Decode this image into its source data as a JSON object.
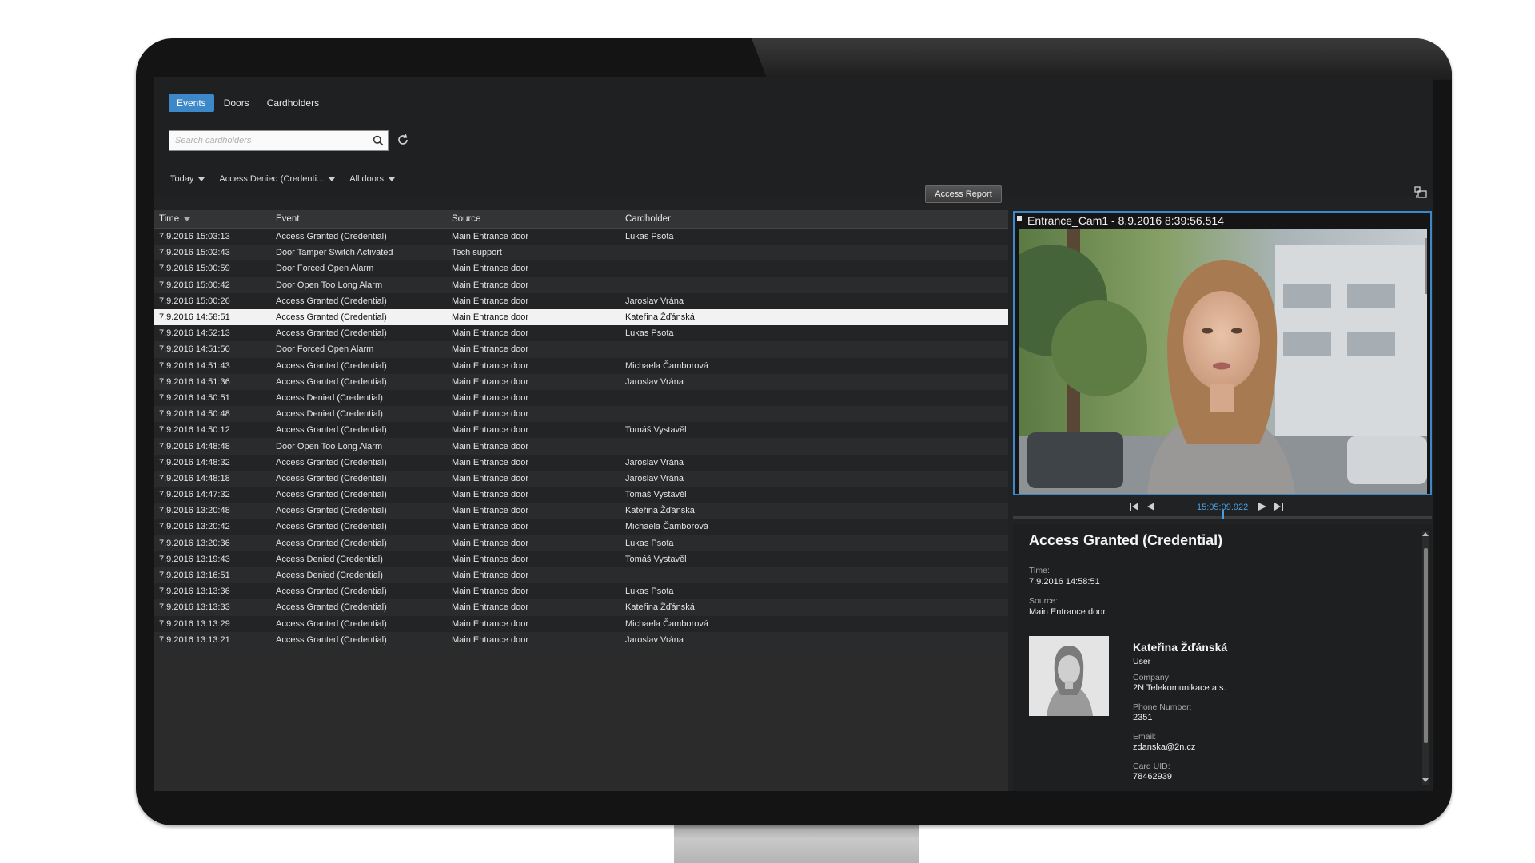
{
  "tabs": [
    {
      "label": "Events",
      "active": true
    },
    {
      "label": "Doors",
      "active": false
    },
    {
      "label": "Cardholders",
      "active": false
    }
  ],
  "search": {
    "placeholder": "Search cardholders",
    "value": ""
  },
  "filters": {
    "period": "Today",
    "event_type": "Access Denied (Credenti...",
    "doors": "All doors"
  },
  "report_button": "Access Report",
  "table": {
    "columns": {
      "time": "Time",
      "event": "Event",
      "source": "Source",
      "cardholder": "Cardholder"
    },
    "selected_index": 5,
    "rows": [
      {
        "time": "7.9.2016 15:03:13",
        "event": "Access Granted (Credential)",
        "source": "Main Entrance door",
        "cardholder": "Lukas Psota"
      },
      {
        "time": "7.9.2016 15:02:43",
        "event": "Door Tamper Switch Activated",
        "source": "Tech support",
        "cardholder": ""
      },
      {
        "time": "7.9.2016 15:00:59",
        "event": "Door Forced Open Alarm",
        "source": "Main Entrance door",
        "cardholder": ""
      },
      {
        "time": "7.9.2016 15:00:42",
        "event": "Door Open Too Long Alarm",
        "source": "Main Entrance door",
        "cardholder": ""
      },
      {
        "time": "7.9.2016 15:00:26",
        "event": "Access Granted (Credential)",
        "source": "Main Entrance door",
        "cardholder": "Jaroslav Vrána"
      },
      {
        "time": "7.9.2016 14:58:51",
        "event": "Access Granted (Credential)",
        "source": "Main Entrance door",
        "cardholder": "Kateřina Žďánská"
      },
      {
        "time": "7.9.2016 14:52:13",
        "event": "Access Granted (Credential)",
        "source": "Main Entrance door",
        "cardholder": "Lukas Psota"
      },
      {
        "time": "7.9.2016 14:51:50",
        "event": "Door Forced Open Alarm",
        "source": "Main Entrance door",
        "cardholder": ""
      },
      {
        "time": "7.9.2016 14:51:43",
        "event": "Access Granted (Credential)",
        "source": "Main Entrance door",
        "cardholder": "Michaela Čamborová"
      },
      {
        "time": "7.9.2016 14:51:36",
        "event": "Access Granted (Credential)",
        "source": "Main Entrance door",
        "cardholder": "Jaroslav Vrána"
      },
      {
        "time": "7.9.2016 14:50:51",
        "event": "Access Denied (Credential)",
        "source": "Main Entrance door",
        "cardholder": ""
      },
      {
        "time": "7.9.2016 14:50:48",
        "event": "Access Denied (Credential)",
        "source": "Main Entrance door",
        "cardholder": ""
      },
      {
        "time": "7.9.2016 14:50:12",
        "event": "Access Granted (Credential)",
        "source": "Main Entrance door",
        "cardholder": "Tomáš Vystavěl"
      },
      {
        "time": "7.9.2016 14:48:48",
        "event": "Door Open Too Long Alarm",
        "source": "Main Entrance door",
        "cardholder": ""
      },
      {
        "time": "7.9.2016 14:48:32",
        "event": "Access Granted (Credential)",
        "source": "Main Entrance door",
        "cardholder": "Jaroslav Vrána"
      },
      {
        "time": "7.9.2016 14:48:18",
        "event": "Access Granted (Credential)",
        "source": "Main Entrance door",
        "cardholder": "Jaroslav Vrána"
      },
      {
        "time": "7.9.2016 14:47:32",
        "event": "Access Granted (Credential)",
        "source": "Main Entrance door",
        "cardholder": "Tomáš Vystavěl"
      },
      {
        "time": "7.9.2016 13:20:48",
        "event": "Access Granted (Credential)",
        "source": "Main Entrance door",
        "cardholder": "Kateřina Žďánská"
      },
      {
        "time": "7.9.2016 13:20:42",
        "event": "Access Granted (Credential)",
        "source": "Main Entrance door",
        "cardholder": "Michaela Čamborová"
      },
      {
        "time": "7.9.2016 13:20:36",
        "event": "Access Granted (Credential)",
        "source": "Main Entrance door",
        "cardholder": "Lukas Psota"
      },
      {
        "time": "7.9.2016 13:19:43",
        "event": "Access Denied (Credential)",
        "source": "Main Entrance door",
        "cardholder": "Tomáš Vystavěl"
      },
      {
        "time": "7.9.2016 13:16:51",
        "event": "Access Denied (Credential)",
        "source": "Main Entrance door",
        "cardholder": ""
      },
      {
        "time": "7.9.2016 13:13:36",
        "event": "Access Granted (Credential)",
        "source": "Main Entrance door",
        "cardholder": "Lukas Psota"
      },
      {
        "time": "7.9.2016 13:13:33",
        "event": "Access Granted (Credential)",
        "source": "Main Entrance door",
        "cardholder": "Kateřina Žďánská"
      },
      {
        "time": "7.9.2016 13:13:29",
        "event": "Access Granted (Credential)",
        "source": "Main Entrance door",
        "cardholder": "Michaela Čamborová"
      },
      {
        "time": "7.9.2016 13:13:21",
        "event": "Access Granted (Credential)",
        "source": "Main Entrance door",
        "cardholder": "Jaroslav Vrána"
      }
    ]
  },
  "video": {
    "title": "Entrance_Cam1 - 8.9.2016 8:39:56.514",
    "playback_time": "15:05:09.922"
  },
  "details": {
    "event_title": "Access Granted (Credential)",
    "time_label": "Time:",
    "time_value": "7.9.2016 14:58:51",
    "source_label": "Source:",
    "source_value": "Main Entrance door",
    "person": {
      "name": "Kateřina Žďánská",
      "role": "User",
      "company_label": "Company:",
      "company": "2N Telekomunikace a.s.",
      "phone_label": "Phone Number:",
      "phone": "2351",
      "email_label": "Email:",
      "email": "zdanska@2n.cz",
      "card_label": "Card UID:",
      "card": "78462939"
    }
  },
  "colors": {
    "accent": "#3c88c8",
    "background": "#212223",
    "selected_row": "#f2f2f2"
  }
}
